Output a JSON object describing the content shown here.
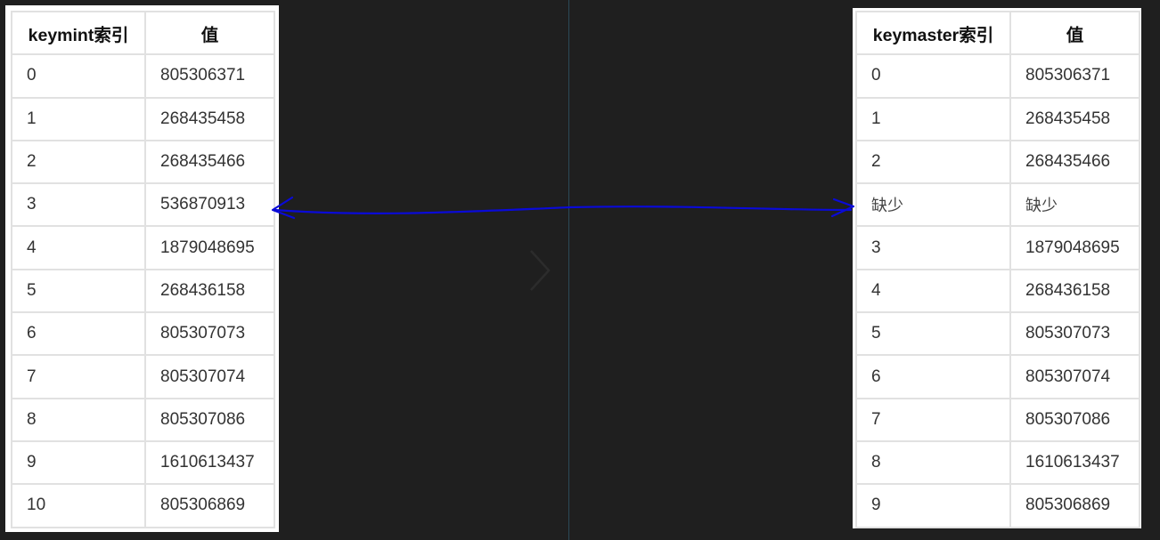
{
  "left_table": {
    "headers": [
      "keymint索引",
      "值"
    ],
    "rows": [
      [
        "0",
        "805306371"
      ],
      [
        "1",
        "268435458"
      ],
      [
        "2",
        "268435466"
      ],
      [
        "3",
        "536870913"
      ],
      [
        "4",
        "1879048695"
      ],
      [
        "5",
        "268436158"
      ],
      [
        "6",
        "805307073"
      ],
      [
        "7",
        "805307074"
      ],
      [
        "8",
        "805307086"
      ],
      [
        "9",
        "1610613437"
      ],
      [
        "10",
        "805306869"
      ]
    ]
  },
  "right_table": {
    "headers": [
      "keymaster索引",
      "值"
    ],
    "rows": [
      [
        "0",
        "805306371"
      ],
      [
        "1",
        "268435458"
      ],
      [
        "2",
        "268435466"
      ],
      [
        "缺少",
        "缺少"
      ],
      [
        "3",
        "1879048695"
      ],
      [
        "4",
        "268436158"
      ],
      [
        "5",
        "805307073"
      ],
      [
        "6",
        "805307074"
      ],
      [
        "7",
        "805307086"
      ],
      [
        "8",
        "1610613437"
      ],
      [
        "9",
        "805306869"
      ]
    ]
  },
  "colors": {
    "background": "#1f1f1f",
    "panel": "#ffffff",
    "grid": "#e1e1e1",
    "arrow": "#0a0ad8",
    "divider": "#2b4a57"
  },
  "icons": {
    "chevron": "chevron-right-icon",
    "arrow": "double-headed-arrow-icon"
  }
}
